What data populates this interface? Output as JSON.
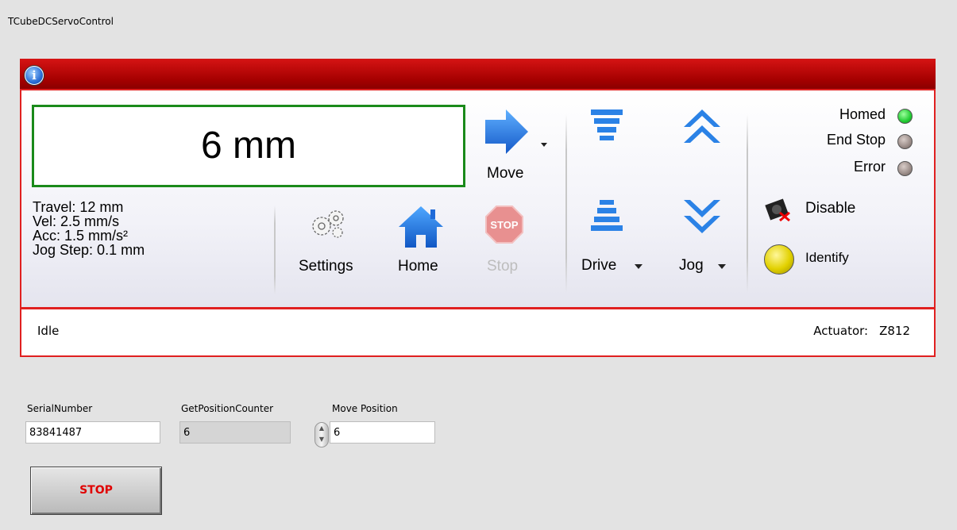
{
  "window": {
    "title": "TCubeDCServoControl"
  },
  "panel": {
    "info_icon_glyph": "i",
    "display_value": "6 mm",
    "params": {
      "travel": "Travel: 12 mm",
      "vel": "Vel: 2.5 mm/s",
      "acc": "Acc: 1.5 mm/s²",
      "jog_step": "Jog Step: 0.1 mm"
    },
    "buttons": {
      "move": "Move",
      "settings": "Settings",
      "home": "Home",
      "stop": "Stop",
      "stop_sign_text": "STOP",
      "drive": "Drive",
      "jog": "Jog",
      "disable": "Disable",
      "identify": "Identify"
    },
    "indicators": {
      "homed": {
        "label": "Homed",
        "color": "#22cc33"
      },
      "end_stop": {
        "label": "End Stop",
        "color": "#9a8c88"
      },
      "error": {
        "label": "Error",
        "color": "#9a8c88"
      }
    },
    "status": {
      "text": "Idle",
      "actuator_label": "Actuator:",
      "actuator_value": "Z812"
    }
  },
  "controls": {
    "serial_number": {
      "label": "SerialNumber",
      "value": "83841487"
    },
    "get_position_counter": {
      "label": "GetPositionCounter",
      "value": "6"
    },
    "move_position": {
      "label": "Move Position",
      "value": "6"
    },
    "stop_button": "STOP"
  },
  "colors": {
    "accent_red": "#e02020",
    "display_border": "#1a8a1a",
    "arrow_blue": "#1e7fe0"
  }
}
